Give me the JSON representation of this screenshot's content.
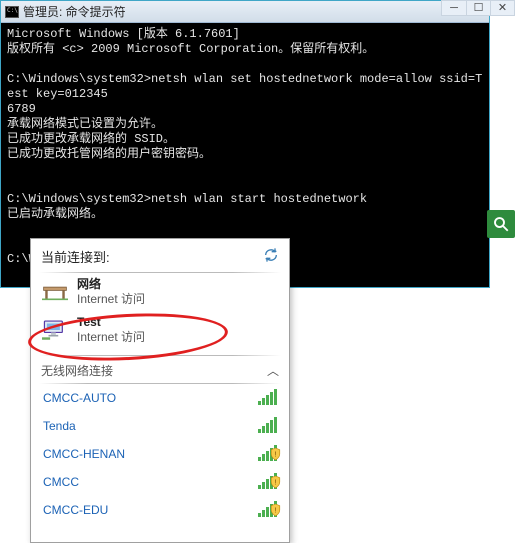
{
  "cmd": {
    "title": "管理员: 命令提示符",
    "lines": {
      "l1": "Microsoft Windows [版本 6.1.7601]",
      "l2": "版权所有 <c> 2009 Microsoft Corporation。保留所有权利。",
      "blank1": "",
      "l3": "C:\\Windows\\system32>netsh wlan set hostednetwork mode=allow ssid=Test key=012345",
      "l3b": "6789",
      "l4": "承载网络模式已设置为允许。",
      "l5": "已成功更改承载网络的 SSID。",
      "l6": "已成功更改托管网络的用户密钥密码。",
      "blank2": "",
      "blank3": "",
      "l7": "C:\\Windows\\system32>netsh wlan start hostednetwork",
      "l8": "已启动承载网络。",
      "blank4": "",
      "blank5": "",
      "l9": "C:\\Windows\\system32>"
    }
  },
  "win_btns": {
    "min": "─",
    "max": "☐",
    "close": "✕"
  },
  "net": {
    "header": "当前连接到:",
    "conn1": {
      "name": "网络",
      "status": "Internet 访问"
    },
    "conn2": {
      "name": "Test",
      "status": "Internet 访问"
    },
    "wifi_section": "无线网络连接",
    "chevron_up": "︿",
    "items": [
      {
        "name": "CMCC-AUTO",
        "shield": false,
        "strength": "full"
      },
      {
        "name": "Tenda",
        "shield": false,
        "strength": "full"
      },
      {
        "name": "CMCC-HENAN",
        "shield": true,
        "strength": "full"
      },
      {
        "name": "CMCC",
        "shield": true,
        "strength": "full"
      },
      {
        "name": "CMCC-EDU",
        "shield": true,
        "strength": "full"
      }
    ]
  }
}
